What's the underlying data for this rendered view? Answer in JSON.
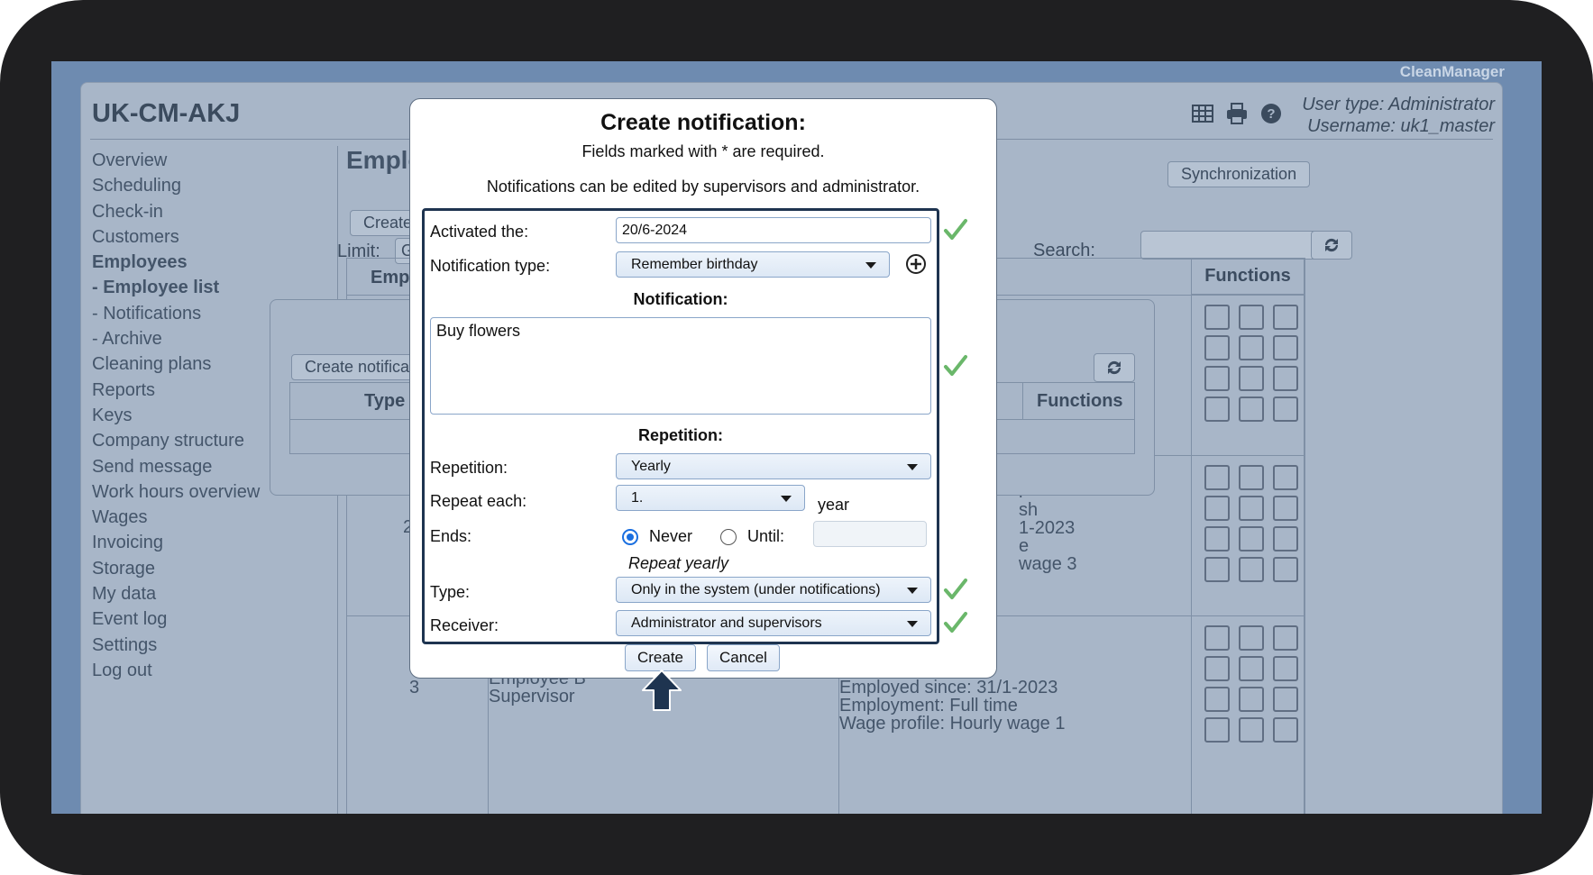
{
  "app": {
    "brand": "CleanManager",
    "title": "UK-CM-AKJ",
    "user_type": "User type: Administrator",
    "username": "Username: uk1_master"
  },
  "nav": {
    "items": [
      {
        "label": "Overview",
        "bold": false
      },
      {
        "label": "Scheduling",
        "bold": false
      },
      {
        "label": "Check-in",
        "bold": false
      },
      {
        "label": "Customers",
        "bold": false
      },
      {
        "label": "Employees",
        "bold": true
      },
      {
        "label": " - Employee list",
        "bold": true
      },
      {
        "label": " - Notifications",
        "bold": false
      },
      {
        "label": " - Archive",
        "bold": false
      },
      {
        "label": "Cleaning plans",
        "bold": false
      },
      {
        "label": "Reports",
        "bold": false
      },
      {
        "label": "Keys",
        "bold": false
      },
      {
        "label": "Company structure",
        "bold": false
      },
      {
        "label": "Send message",
        "bold": false
      },
      {
        "label": "Work hours overview",
        "bold": false
      },
      {
        "label": "Wages",
        "bold": false
      },
      {
        "label": "Invoicing",
        "bold": false
      },
      {
        "label": "Storage",
        "bold": false
      },
      {
        "label": "My data",
        "bold": false
      },
      {
        "label": "Event log",
        "bold": false
      },
      {
        "label": "Settings",
        "bold": false
      },
      {
        "label": "Log out",
        "bold": false
      }
    ]
  },
  "background": {
    "section_title": "Employee",
    "create_button": "Create e",
    "limit_label": "Limit:",
    "limit_button": "G",
    "search_label": "Search:",
    "sync_button": "Synchronization",
    "col_empl": "Empl.",
    "col_functions": "Functions",
    "inner_create_button": "Create notificatio",
    "inner_col_type": "Type",
    "inner_col_functions": "Functions",
    "row_num_a": "2",
    "row_num_b": "3",
    "row2_text": [
      "r",
      "sh",
      "1-2023",
      "e",
      "wage 3"
    ],
    "row3_name": "Employee B",
    "row3_role": "Supervisor",
    "row3_details": [
      "r",
      "sh",
      "Employed since: 31/1-2023",
      "Employment: Full time",
      "Wage profile: Hourly wage 1"
    ]
  },
  "modal": {
    "title": "Create notification:",
    "required_note": "Fields marked with * are required.",
    "edit_note": "Notifications can be edited by supervisors and administrator.",
    "activated_label": "Activated the:",
    "activated_value": "20/6-2024",
    "type_label": "Notification type:",
    "type_value": "Remember birthday",
    "notification_header": "Notification:",
    "notification_text": "Buy flowers",
    "repetition_header": "Repetition:",
    "repetition_label": "Repetition:",
    "repetition_value": "Yearly",
    "repeat_each_label": "Repeat each:",
    "repeat_each_value": "1.",
    "repeat_each_unit": "year",
    "ends_label": "Ends:",
    "ends_never": "Never",
    "ends_until": "Until:",
    "ends_selected": "Never",
    "repeat_summary": "Repeat yearly",
    "send_type_label": "Type:",
    "send_type_value": "Only in the system (under notifications)",
    "receiver_label": "Receiver:",
    "receiver_value": "Administrator and supervisors",
    "create_button": "Create",
    "cancel_button": "Cancel"
  },
  "colors": {
    "check_green": "#6ab76a",
    "accent_navy": "#1e3450",
    "overlay": "#a8b6c8"
  }
}
